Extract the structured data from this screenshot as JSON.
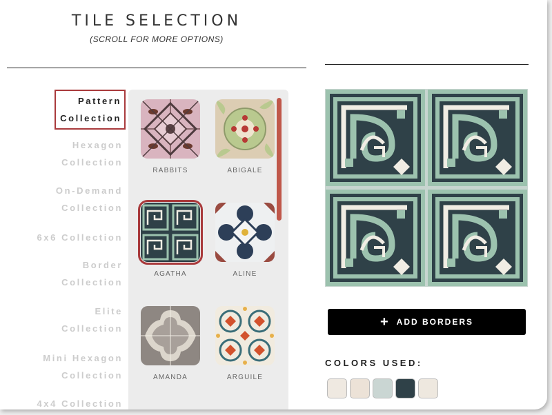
{
  "header": {
    "title": "TILE SELECTION",
    "subtitle": "(SCROLL FOR MORE OPTIONS)"
  },
  "categories": [
    {
      "line1": "Pattern",
      "line2": "Collection",
      "active": true
    },
    {
      "line1": "Hexagon",
      "line2": "Collection",
      "active": false
    },
    {
      "line1": "On-Demand",
      "line2": "Collection",
      "active": false
    },
    {
      "line1": "6x6 Collection",
      "line2": "",
      "active": false
    },
    {
      "line1": "Border",
      "line2": "Collection",
      "active": false
    },
    {
      "line1": "Elite",
      "line2": "Collection",
      "active": false
    },
    {
      "line1": "Mini Hexagon",
      "line2": "Collection",
      "active": false
    },
    {
      "line1": "4x4 Collection",
      "line2": "",
      "active": false
    }
  ],
  "tiles": [
    {
      "name": "RABBITS",
      "icon": "rabbits-tile-icon",
      "selected": false
    },
    {
      "name": "ABIGALE",
      "icon": "abigale-tile-icon",
      "selected": false
    },
    {
      "name": "AGATHA",
      "icon": "agatha-tile-icon",
      "selected": true
    },
    {
      "name": "ALINE",
      "icon": "aline-tile-icon",
      "selected": false
    },
    {
      "name": "AMANDA",
      "icon": "amanda-tile-icon",
      "selected": false
    },
    {
      "name": "ARGUILE",
      "icon": "arguile-tile-icon",
      "selected": false
    }
  ],
  "actions": {
    "add_borders": "ADD BORDERS",
    "add_icon": "plus-icon"
  },
  "colors": {
    "label": "COLORS USED:",
    "swatches": [
      "#efe9e1",
      "#ece2d7",
      "#cad6d3",
      "#2f4148",
      "#eee8df"
    ]
  },
  "palette": {
    "accent": "#a93a3c",
    "scrollbar": "#c0574a",
    "tile_dark": "#2f4148",
    "tile_mint": "#9cc2ae",
    "tile_cream": "#f1ede4"
  }
}
